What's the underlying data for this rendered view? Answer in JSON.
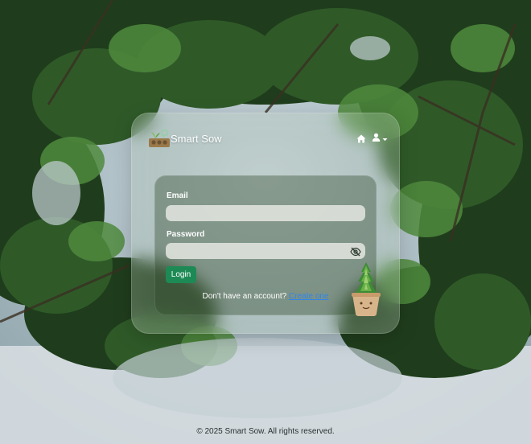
{
  "header": {
    "brand": "Smart Sow"
  },
  "form": {
    "email_label": "Email",
    "email_value": "",
    "password_label": "Password",
    "password_value": "",
    "login_label": "Login",
    "signup_prompt": "Don't have an account?",
    "signup_link": "Create one"
  },
  "footer": {
    "text": "© 2025 Smart Sow. All rights reserved."
  },
  "icons": {
    "logo": "seed-tray-logo",
    "home": "home-icon",
    "user": "user-icon",
    "dropdown": "caret-down-icon",
    "password_toggle": "eye-slash-icon",
    "decoration": "potted-plant"
  },
  "colors": {
    "primary_button": "#1d8a55",
    "link": "#2f86e8",
    "text_on_card": "#ffffff"
  }
}
